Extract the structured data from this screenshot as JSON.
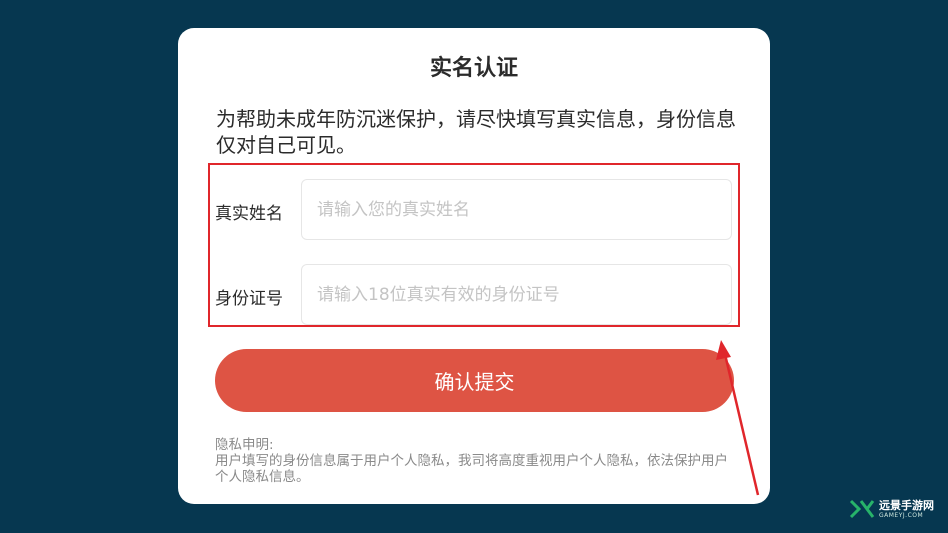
{
  "dialog": {
    "title": "实名认证",
    "intro": "为帮助未成年防沉迷保护，请尽快填写真实信息，身份信息仅对自己可见。",
    "fields": {
      "name": {
        "label": "真实姓名",
        "placeholder": "请输入您的真实姓名",
        "value": ""
      },
      "id": {
        "label": "身份证号",
        "placeholder": "请输入18位真实有效的身份证号",
        "value": ""
      }
    },
    "submit_label": "确认提交",
    "privacy_title": "隐私申明:",
    "privacy_body": "用户填写的身份信息属于用户个人隐私，我司将高度重视用户个人隐私，依法保护用户个人隐私信息。"
  },
  "watermark": {
    "name": "远景手游网",
    "sub": "GAMEYJ.COM"
  },
  "colors": {
    "background": "#063750",
    "button": "#de5444",
    "highlight": "#e0262b",
    "watermark_green": "#27b36a"
  }
}
